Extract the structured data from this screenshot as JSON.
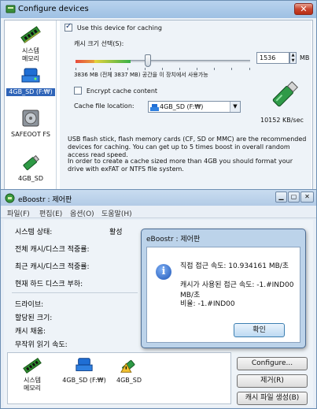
{
  "configure_window": {
    "title": "Configure devices",
    "devices": [
      {
        "label": "시스템\n메모리",
        "icon": "ram-module-icon"
      },
      {
        "label": "4GB_SD (F:₩)",
        "icon": "usb-drive-icon",
        "selected": true
      },
      {
        "label": "SAFEOOT FS",
        "icon": "hard-disk-icon"
      },
      {
        "label": "4GB_SD",
        "icon": "usb-stick-icon"
      }
    ],
    "use_cache_label": "Use this device for caching",
    "use_cache_checked": true,
    "cache_size_label": "캐시 크기 선택(S):",
    "cache_size_value": "1536",
    "cache_size_unit": "MB",
    "slider_level_percent": 41,
    "space_text": "3836 MB (전체 3837 MB) 공간을 이 장치에서 사용가능",
    "encrypt_label": "Encrypt cache content",
    "encrypt_checked": false,
    "location_label": "Cache file location:",
    "location_value": "4GB_SD (F:₩)",
    "speed_text": "10152 KB/sec",
    "note1": "USB flash stick, flash memory cards (CF, SD or MMC) are the recommended devices for caching. You can get up to 5 times boost in overall random access read speed.",
    "note2": "In order to create a cache sized more than 4GB you should format your drive with exFAT or NTFS file system."
  },
  "eboostr_window": {
    "title": "eBoostr : 제어판",
    "menu": [
      "파일(F)",
      "편집(E)",
      "옵션(O)",
      "도움말(H)"
    ],
    "status_label": "시스템 상태:",
    "status_value": "활성",
    "total_hit_label": "전체 캐시/디스크 적중률:",
    "recent_hit_label": "최근 캐시/디스크 적중률:",
    "hdd_load_label": "현재 하드 디스크 부하:",
    "drive_label": "드라이브:",
    "alloc_label": "할당된 크기:",
    "cache_fill_label": "캐시 채움:",
    "random_read_label": "무작위 읽기 속도:",
    "device_bar": [
      {
        "label": "시스템\n메모리",
        "icon": "ram-module-icon"
      },
      {
        "label": "4GB_SD (F:₩)",
        "icon": "usb-drive-icon"
      },
      {
        "label": "4GB_SD",
        "icon": "usb-warning-icon"
      }
    ],
    "buttons": {
      "configure": "Configure...",
      "remove": "제거(R)",
      "create_cache": "캐시 파일 생성(B)"
    }
  },
  "dialog": {
    "title": "eBoostr : 제어판",
    "line1": "직접 접근 속도: 10.934161 MB/초",
    "line2": "캐시가 사용된 접근 속도: -1.#IND00 MB/초",
    "line3": "비율: -1.#IND00",
    "ok": "확인"
  }
}
